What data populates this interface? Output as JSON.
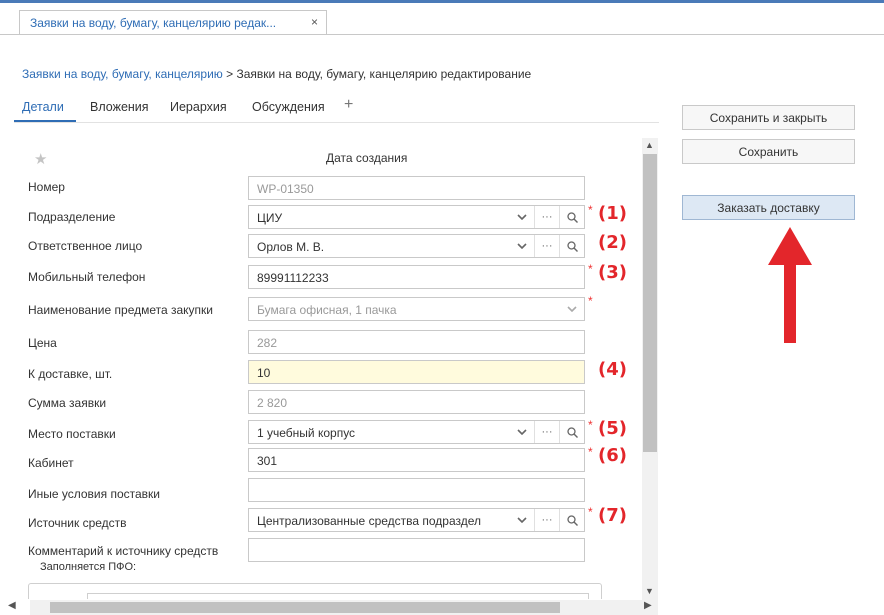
{
  "tab": {
    "title": "Заявки на воду, бумагу, канцелярию редак...",
    "close": "×"
  },
  "breadcrumb": {
    "link": "Заявки на воду, бумагу, канцелярию",
    "rest": " > Заявки на воду, бумагу, канцелярию редактирование"
  },
  "subtabs": [
    "Детали",
    "Вложения",
    "Иерархия",
    "Обсуждения"
  ],
  "add_tab": "+",
  "header": {
    "created_label": "Дата создания"
  },
  "fields": [
    {
      "label": "Номер",
      "value": "WP-01350"
    },
    {
      "label": "Подразделение",
      "value": "ЦИУ"
    },
    {
      "label": "Ответственное лицо",
      "value": "Орлов М. В."
    },
    {
      "label": "Мобильный телефон",
      "value": "89991112233"
    },
    {
      "label": "Наименование предмета закупки",
      "value": "Бумага офисная, 1 пачка"
    },
    {
      "label": "Цена",
      "value": "282"
    },
    {
      "label": "К доставке, шт.",
      "value": "10"
    },
    {
      "label": "Сумма заявки",
      "value": "2 820"
    },
    {
      "label": "Место поставки",
      "value": "1 учебный корпус"
    },
    {
      "label": "Кабинет",
      "value": "301"
    },
    {
      "label": "Иные условия поставки",
      "value": ""
    },
    {
      "label": "Источник средств",
      "value": "Централизованные средства подраздел"
    },
    {
      "label": "Комментарий к источнику средств",
      "value": ""
    }
  ],
  "sub_label": "Заполняется ПФО:",
  "required_mark": "*",
  "annotations": [
    "(1)",
    "(2)",
    "(3)",
    "(4)",
    "(5)",
    "(6)",
    "(7)"
  ],
  "buttons": {
    "save_close": "Сохранить и закрыть",
    "save": "Сохранить",
    "order_delivery": "Заказать доставку"
  },
  "colors": {
    "link": "#2f6db5",
    "required": "#e33333",
    "annotation": "#e3262b",
    "highlight_field": "#fffbdd",
    "primary_button": "#dde8f4"
  }
}
